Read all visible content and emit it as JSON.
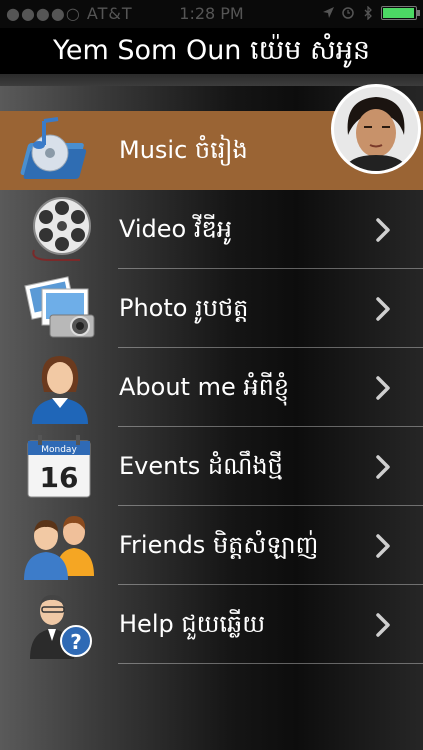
{
  "status_bar": {
    "carrier": "●●●●○ AT&T",
    "time": "1:28 PM"
  },
  "header": {
    "title": "Yem Som Oun យ៉េម សំអូន"
  },
  "menu": {
    "items": [
      {
        "label": "Music ចំរៀង",
        "icon": "music-cd-icon",
        "selected": true
      },
      {
        "label": "Video វីឌីអូ",
        "icon": "film-reel-icon",
        "selected": false
      },
      {
        "label": "Photo រូបថត្ត",
        "icon": "camera-photos-icon",
        "selected": false
      },
      {
        "label": "About me អំពីខ្ញុំ",
        "icon": "person-icon",
        "selected": false
      },
      {
        "label": "Events ដំណឹងថ្មី",
        "icon": "calendar-icon",
        "selected": false
      },
      {
        "label": "Friends មិត្តសំឡាញ់",
        "icon": "friends-icon",
        "selected": false
      },
      {
        "label": "Help ជួយឆ្លើយ",
        "icon": "help-icon",
        "selected": false
      }
    ],
    "calendar": {
      "month": "Monday",
      "day": "16"
    }
  },
  "colors": {
    "selected_row": "#9a6434",
    "battery": "#4cd964"
  }
}
